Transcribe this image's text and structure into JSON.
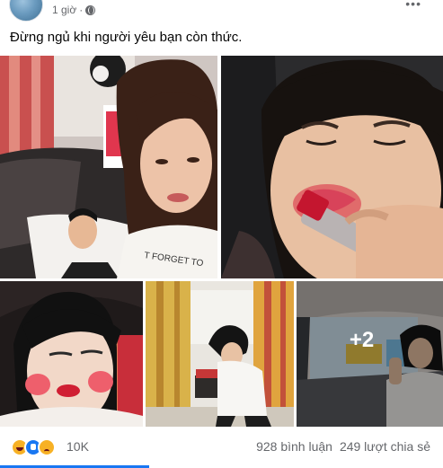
{
  "post": {
    "time": "1 giờ",
    "separator": "·",
    "more": "•••",
    "caption": "Đừng ngủ khi người yêu bạn còn thức."
  },
  "photos": {
    "more_count": "+2"
  },
  "footer": {
    "reactions": [
      "haha",
      "like",
      "sad"
    ],
    "reaction_count": "10K",
    "comments": "928 bình luận",
    "shares": "249 lượt chia sẻ"
  },
  "colors": {
    "accent": "#1877f2",
    "secondary_text": "#65676b"
  }
}
